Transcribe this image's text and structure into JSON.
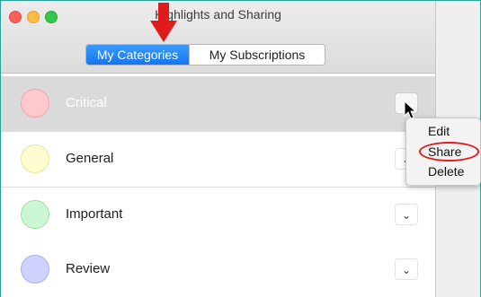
{
  "window": {
    "title": "Highlights and Sharing"
  },
  "tabs": [
    {
      "label": "My Categories",
      "active": true
    },
    {
      "label": "My Subscriptions",
      "active": false
    }
  ],
  "categories": [
    {
      "name": "Critical",
      "color": "#ffc9cc",
      "border": "#f1a3a8",
      "selected": true
    },
    {
      "name": "General",
      "color": "#fffcd0",
      "border": "#eae29e",
      "selected": false
    },
    {
      "name": "Important",
      "color": "#cdf7d4",
      "border": "#9fe0ab",
      "selected": false
    },
    {
      "name": "Review",
      "color": "#cfd2ff",
      "border": "#a9aeeb",
      "selected": false
    }
  ],
  "row_menu": {
    "items": [
      {
        "label": "Edit"
      },
      {
        "label": "Share",
        "highlighted": true
      },
      {
        "label": "Delete"
      }
    ]
  },
  "icons": {
    "chevron": "chevron-down-icon",
    "annotation_arrow": "red-arrow-down-icon",
    "pointer": "mouse-pointer-icon"
  },
  "colors": {
    "segmented_active": "#1a7cf4",
    "annotation_red": "#e01b1b",
    "frame_teal": "#2aa19a"
  }
}
